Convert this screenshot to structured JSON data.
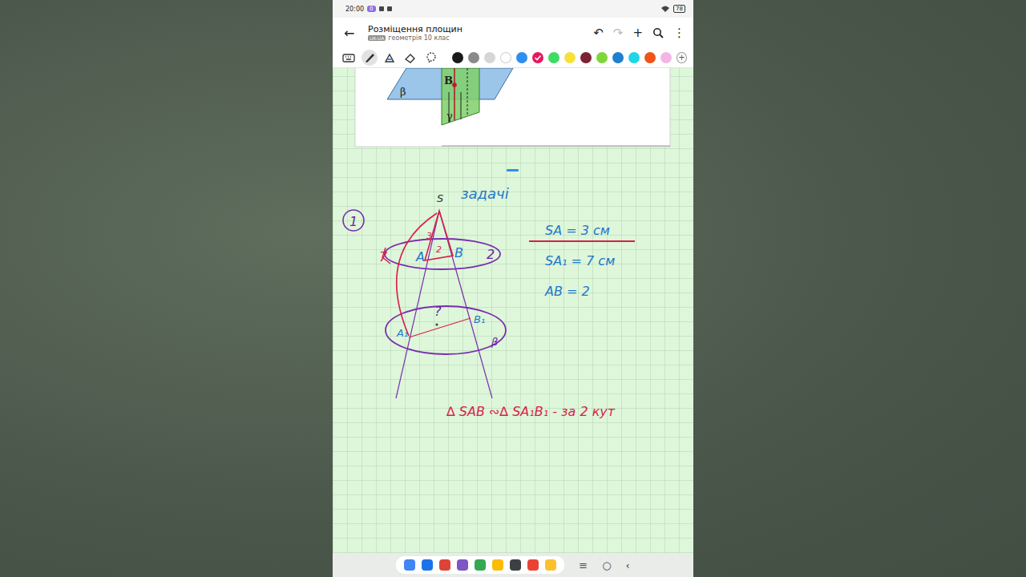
{
  "status_bar": {
    "time": "20:00",
    "count": "0",
    "battery": "78"
  },
  "app_bar": {
    "back": "←",
    "title": "Розміщення площин",
    "badge": "UK-UA",
    "subtitle": "геометрія 10 клас",
    "actions": [
      "↶",
      "↷",
      "+"
    ],
    "more": "⋮"
  },
  "toolbar": {
    "tools": [
      {
        "kind": "keyboard",
        "selected": false
      },
      {
        "kind": "pen",
        "selected": true
      },
      {
        "kind": "highlighter",
        "selected": false
      },
      {
        "kind": "eraser",
        "selected": false
      },
      {
        "kind": "lasso",
        "selected": false
      }
    ],
    "colors": [
      {
        "color": "#1a1a1a",
        "selected": false
      },
      {
        "color": "#8a8a8a",
        "selected": false
      },
      {
        "color": "#d6d6d6",
        "selected": false
      },
      {
        "color": "#ffffff",
        "selected": false
      },
      {
        "color": "#2f8ff0",
        "selected": false
      },
      {
        "color": "#e8175d",
        "selected": true
      },
      {
        "color": "#3ddc63",
        "selected": false
      },
      {
        "color": "#f5e13a",
        "selected": false
      },
      {
        "color": "#7b2233",
        "selected": false
      },
      {
        "color": "#7fd63a",
        "selected": false
      },
      {
        "color": "#1f7fd1",
        "selected": false
      },
      {
        "color": "#1fd6e6",
        "selected": false
      },
      {
        "color": "#f0531c",
        "selected": false
      },
      {
        "color": "#f2b6e6",
        "selected": false
      }
    ],
    "add": "+"
  },
  "figure": {
    "plane_beta": "β",
    "point": "B",
    "plane_gamma": "γ"
  },
  "notes": {
    "number": "1",
    "vertex": "S",
    "heading": "задачі",
    "top_A": "A",
    "top_B": "B",
    "mark_SA": "3",
    "mark_AB": "2",
    "mark_SA1": "7",
    "mark_side": "2",
    "bottom_A": "A₁",
    "bottom_B": "B₁",
    "unknown": "?",
    "plane": "β",
    "given": [
      "SA = 3 см",
      "SA₁ = 7 см",
      "AB = 2"
    ],
    "conclusion": "∆ SAB ∾∆ SA₁B₁ - за 2 кут"
  },
  "nav": {
    "apps": [
      {
        "color": "#4285f4"
      },
      {
        "color": "#1a73e8"
      },
      {
        "color": "#db4437"
      },
      {
        "color": "#7e57c2"
      },
      {
        "color": "#34a853"
      },
      {
        "color": "#fbbc05"
      },
      {
        "color": "#3c4043"
      },
      {
        "color": "#ea4335"
      },
      {
        "color": "#fbc02d"
      }
    ],
    "buttons": [
      "≡",
      "○",
      "‹"
    ]
  }
}
